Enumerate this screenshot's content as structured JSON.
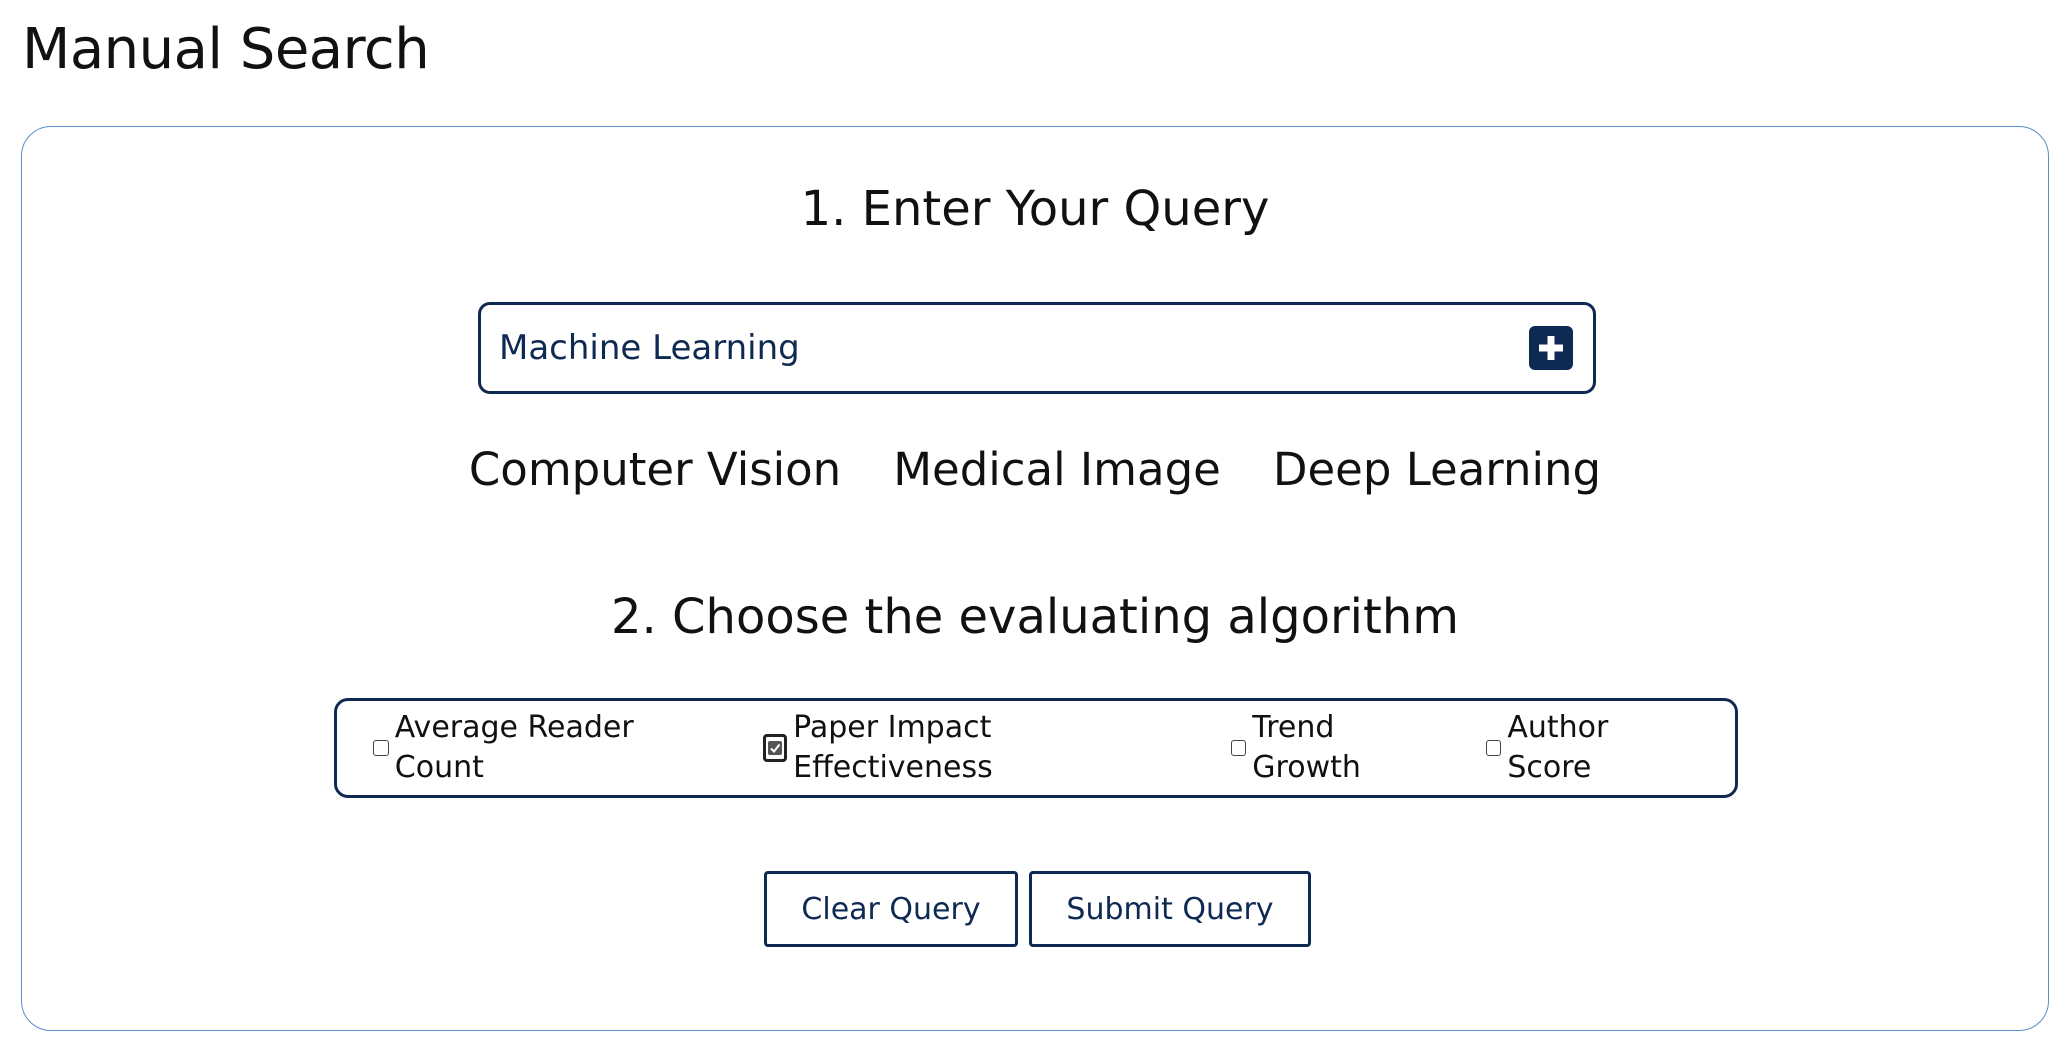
{
  "page": {
    "title": "Manual Search"
  },
  "query_section": {
    "heading": "1. Enter Your Query",
    "input_value": "Machine Learning",
    "add_icon": "plus-square-icon",
    "suggestions": [
      "Computer Vision",
      "Medical Image",
      "Deep Learning"
    ]
  },
  "algorithm_section": {
    "heading": "2. Choose the evaluating algorithm",
    "options": [
      {
        "label": "Average Reader Count",
        "checked": false
      },
      {
        "label": "Paper Impact Effectiveness",
        "checked": true
      },
      {
        "label": "Trend Growth",
        "checked": false
      },
      {
        "label": "Author Score",
        "checked": false
      }
    ]
  },
  "actions": {
    "clear_label": "Clear Query",
    "submit_label": "Submit Query"
  },
  "colors": {
    "accent": "#0f2a52",
    "panel_border": "#5a8fc6"
  }
}
